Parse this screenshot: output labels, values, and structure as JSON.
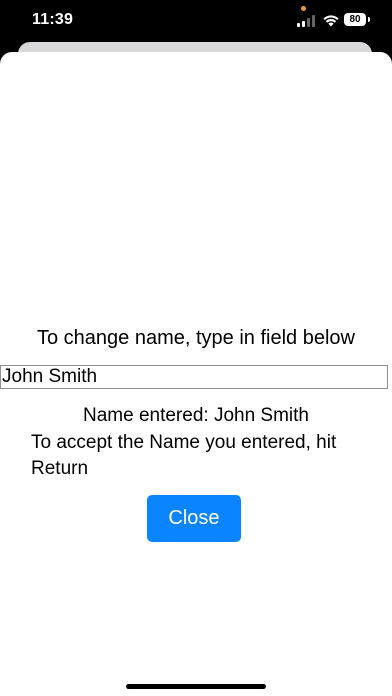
{
  "status_bar": {
    "time": "11:39",
    "battery_level": "80",
    "icons": [
      "signal-icon",
      "wifi-icon",
      "battery-icon"
    ],
    "privacy_indicator_color": "#f19a37"
  },
  "form": {
    "prompt": "To change name, type in field below",
    "name_value": "John Smith",
    "entered_text": "Name entered: John Smith",
    "accept_hint": "To accept the Name you entered, hit Return",
    "close_label": "Close"
  },
  "colors": {
    "accent": "#0a84ff",
    "sheet_background": "#ffffff",
    "background": "#000000"
  }
}
